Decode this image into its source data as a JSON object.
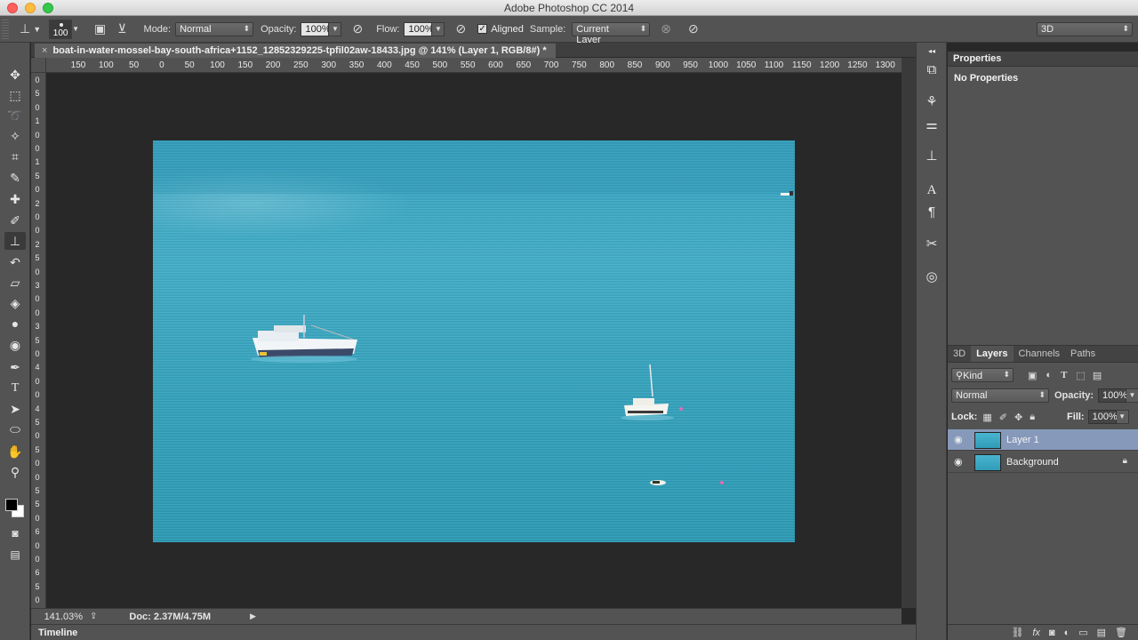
{
  "window": {
    "title": "Adobe Photoshop CC 2014"
  },
  "options_bar": {
    "brush_size": "100",
    "mode_label": "Mode:",
    "mode_value": "Normal",
    "opacity_label": "Opacity:",
    "opacity_value": "100%",
    "flow_label": "Flow:",
    "flow_value": "100%",
    "aligned_label": "Aligned",
    "aligned_checked": "✓",
    "sample_label": "Sample:",
    "sample_value": "Current Layer",
    "workspace_value": "3D"
  },
  "document": {
    "tab_label": "boat-in-water-mossel-bay-south-africa+1152_12852329225-tpfil02aw-18433.jpg @ 141% (Layer 1, RGB/8#) *",
    "close_glyph": "×"
  },
  "ruler": {
    "h_ticks": [
      "150",
      "100",
      "50",
      "0",
      "50",
      "100",
      "150",
      "200",
      "250",
      "300",
      "350",
      "400",
      "450",
      "500",
      "550",
      "600",
      "650",
      "700",
      "750",
      "800",
      "850",
      "900",
      "950",
      "1000",
      "1050",
      "1100",
      "1150",
      "1200",
      "1250",
      "1300"
    ],
    "v_labels": [
      "0",
      "5",
      "0",
      "1",
      "0",
      "0",
      "1",
      "5",
      "0",
      "2",
      "0",
      "0",
      "2",
      "5",
      "0",
      "3",
      "0",
      "0",
      "3",
      "5",
      "0",
      "4",
      "0",
      "0",
      "4",
      "5",
      "0",
      "5",
      "0",
      "0",
      "5",
      "5",
      "0",
      "6",
      "0",
      "0",
      "6",
      "5",
      "0"
    ]
  },
  "status": {
    "zoom": "141.03%",
    "doc_size": "Doc: 2.37M/4.75M"
  },
  "timeline": {
    "label": "Timeline"
  },
  "properties": {
    "title": "Properties",
    "body": "No Properties"
  },
  "layers_panel": {
    "tabs": [
      "3D",
      "Layers",
      "Channels",
      "Paths"
    ],
    "filter_label": "Kind",
    "blend_mode": "Normal",
    "opacity_label": "Opacity:",
    "opacity_value": "100%",
    "lock_label": "Lock:",
    "fill_label": "Fill:",
    "fill_value": "100%",
    "layers": [
      {
        "name": "Layer 1",
        "selected": true
      },
      {
        "name": "Background",
        "locked": true
      }
    ]
  }
}
